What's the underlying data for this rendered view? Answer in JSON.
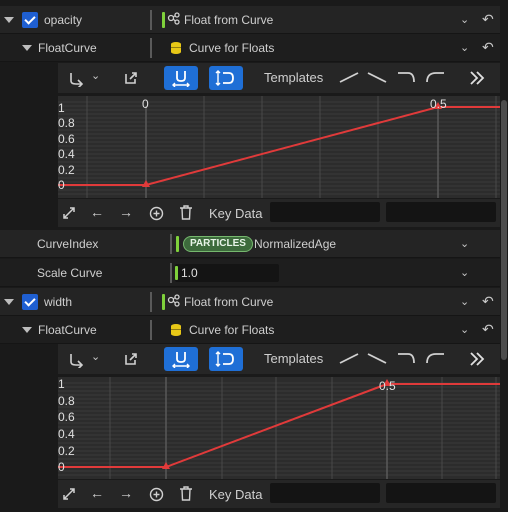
{
  "section1": {
    "param_name": "opacity",
    "module_label": "Float from Curve",
    "curve_row_label": "FloatCurve",
    "curve_value": "Curve for Floats",
    "templates_label": "Templates",
    "key_data_label": "Key Data",
    "y_labels": [
      "1",
      "0.8",
      "0.6",
      "0.4",
      "0.2",
      "0"
    ],
    "x_labels": [
      "0",
      "0.5"
    ]
  },
  "curve_index": {
    "label": "CurveIndex",
    "badge": "PARTICLES",
    "value": "NormalizedAge"
  },
  "scale_curve": {
    "label": "Scale Curve",
    "value": "1.0"
  },
  "section2": {
    "param_name": "width",
    "module_label": "Float from Curve",
    "curve_row_label": "FloatCurve",
    "curve_value": "Curve for Floats",
    "templates_label": "Templates",
    "key_data_label": "Key Data",
    "y_labels": [
      "1",
      "0.8",
      "0.6",
      "0.4",
      "0.2",
      "0"
    ],
    "x_labels": [
      "0.5"
    ]
  },
  "icons": {
    "expand": "triangle-down-icon",
    "module": "curve-module-icon",
    "asset": "database-icon",
    "reset": "reset-arrow-icon",
    "chevron": "chevron-down-icon"
  },
  "colors": {
    "accent": "#1f6fd6",
    "curve": "#e03a3a",
    "particles_badge": "#3d6b3c"
  }
}
